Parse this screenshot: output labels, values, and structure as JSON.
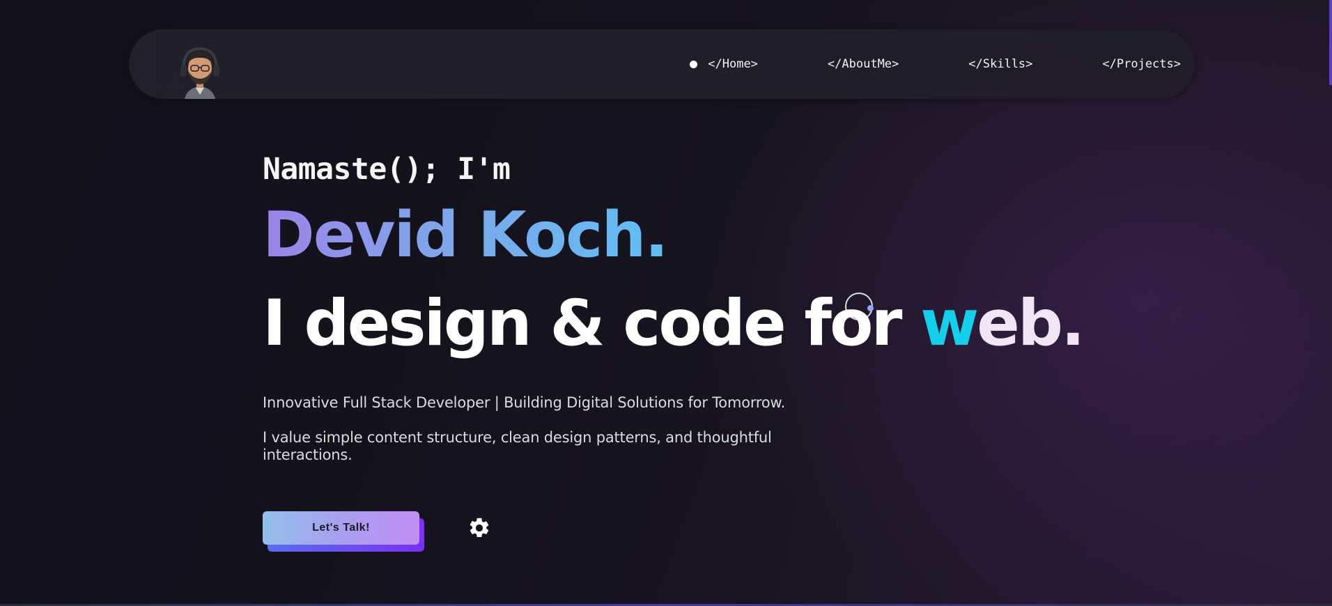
{
  "nav": {
    "items": [
      {
        "label": "</Home>",
        "active": true
      },
      {
        "label": "</AboutMe>",
        "active": false
      },
      {
        "label": "</Skills>",
        "active": false
      },
      {
        "label": "</Projects>",
        "active": false
      }
    ],
    "avatar_icon": "avatar-memoji"
  },
  "hero": {
    "greeting": "Namaste(); I'm",
    "name": "Devid Koch.",
    "tagline_main": "I design & code for ",
    "tagline_accent": "w",
    "tagline_end": "eb.",
    "subtitle": "Innovative Full Stack Developer | Building Digital Solutions for Tomorrow.",
    "description": "I value simple content structure, clean design patterns, and thoughtful interactions.",
    "cta_label": "Let's Talk!",
    "settings_icon": "gear-icon"
  },
  "colors": {
    "background": "#13121b",
    "name_gradient_start": "#9d84e8",
    "name_gradient_end": "#5fbef3",
    "accent_cyan": "#13d0ec",
    "button_gradient_start": "#93c0ea",
    "button_gradient_end": "#c18ff5",
    "button_shadow": "#7b2ff7"
  }
}
